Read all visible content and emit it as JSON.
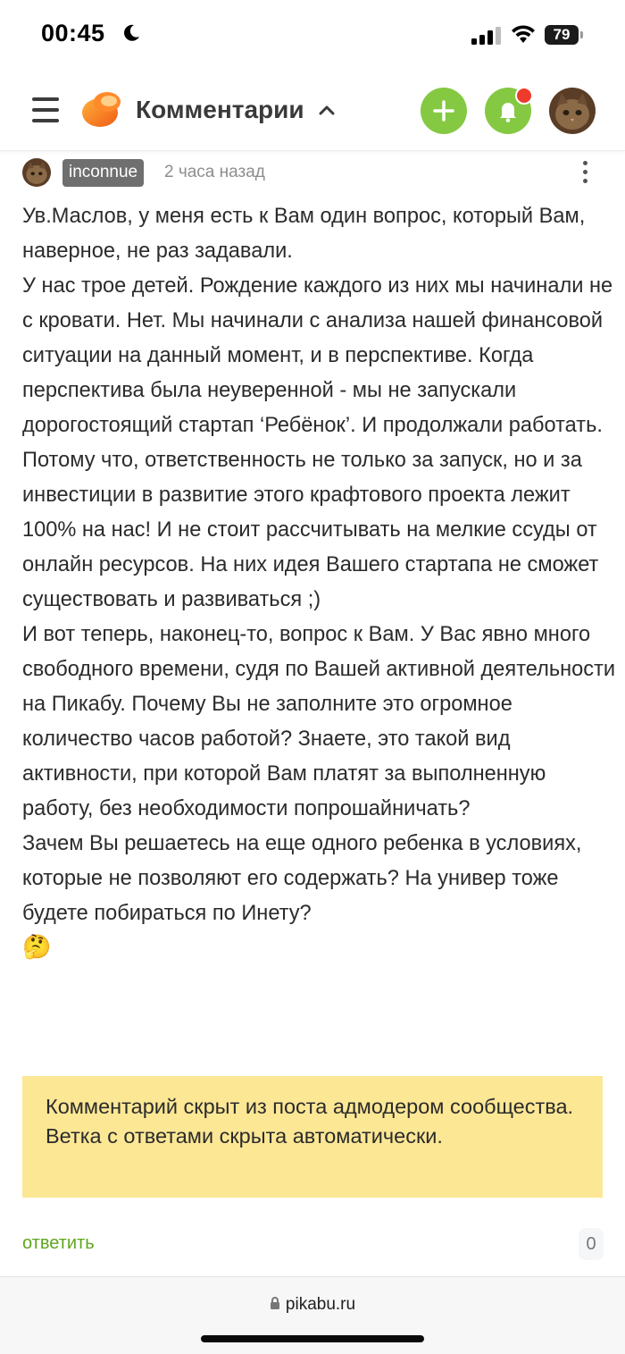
{
  "status_bar": {
    "time": "00:45",
    "battery": "79"
  },
  "header": {
    "title": "Комментарии"
  },
  "comment": {
    "username": "inconnue",
    "time_ago": "2 часа назад",
    "paragraphs": [
      "Ув.Маслов, у меня есть к Вам один вопрос, который Вам, наверное, не раз задавали.",
      "У нас трое детей. Рождение каждого из них мы начинали не с кровати. Нет. Мы начинали с анализа нашей финансовой ситуации на данный момент, и в перспективе. Когда перспектива была неуверенной - мы не запускали дорогостоящий стартап ‘Ребёнок’. И продолжали работать.",
      "Потому что, ответственность не только за запуск, но и за инвестиции в развитие этого крафтового проекта лежит 100% на нас! И не стоит рассчитывать на мелкие ссуды от онлайн ресурсов. На них идея Вашего стартапа не сможет существовать и развиваться ;)",
      "И вот теперь, наконец-то, вопрос к Вам. У Вас явно много свободного времени, судя по Вашей активной деятельности на Пикабу. Почему Вы не заполните это огромное количество часов работой? Знаете, это такой вид активности, при которой Вам платят за выполненную работу, без необходимости попрошайничать?",
      "Зачем Вы решаетесь на еще одного ребенка в условиях, которые не позволяют его содержать? На универ тоже будете побираться по Инету?"
    ],
    "emoji": "🤔",
    "hidden_notice": "Комментарий скрыт из поста адмодером сообщества. Ветка с ответами скрыта автоматически.",
    "reply_label": "ответить",
    "reply_count": "0"
  },
  "browser": {
    "url": "pikabu.ru"
  },
  "colors": {
    "accent_green": "#85c943",
    "reply_green": "#5fa61e",
    "notice_bg": "#fce795",
    "notification_dot": "#ef3b2c"
  }
}
